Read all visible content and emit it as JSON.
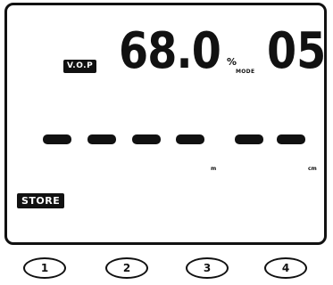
{
  "display": {
    "vop_label": "V.O.P",
    "vop_value": "68.0",
    "vop_unit": "%",
    "mode_label": "MODE",
    "mode_value": "05",
    "store_label": "STORE",
    "unit_m": "m",
    "unit_cm": "cm"
  },
  "buttons": [
    {
      "label": "1"
    },
    {
      "label": "2"
    },
    {
      "label": "3"
    },
    {
      "label": "4"
    }
  ],
  "colors": {
    "lcd_ink": "#111111",
    "background": "#ffffff"
  }
}
